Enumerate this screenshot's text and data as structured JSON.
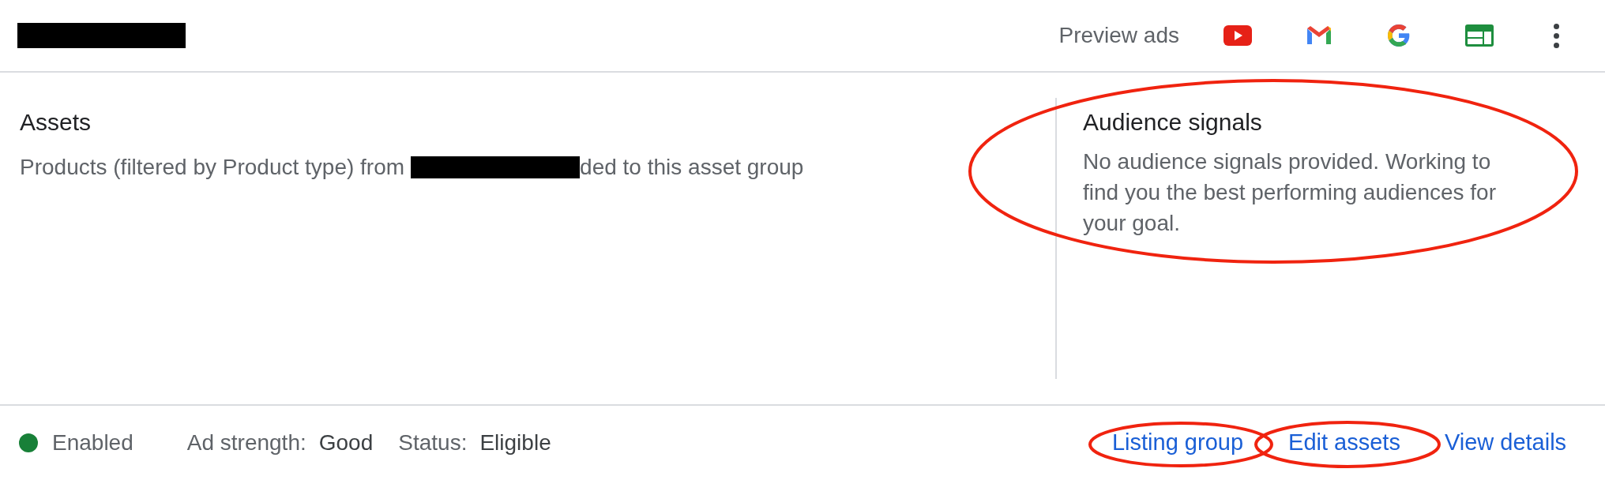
{
  "header": {
    "preview_label": "Preview ads",
    "preview_icons": [
      {
        "kind": "youtube"
      },
      {
        "kind": "gmail"
      },
      {
        "kind": "google"
      },
      {
        "kind": "display"
      }
    ]
  },
  "assets": {
    "title": "Assets",
    "text_before": "Products (filtered by Product type) from",
    "text_after": "ded to this asset group"
  },
  "audience": {
    "title": "Audience signals",
    "text": "No audience signals provided. Working to find you the best performing audiences for your goal."
  },
  "footer": {
    "state": {
      "label": "Enabled",
      "color": "#188038"
    },
    "ad_strength": {
      "label": "Ad strength:",
      "value": "Good"
    },
    "status": {
      "label": "Status:",
      "value": "Eligible"
    },
    "links": [
      "Listing group",
      "Edit assets",
      "View details"
    ]
  }
}
